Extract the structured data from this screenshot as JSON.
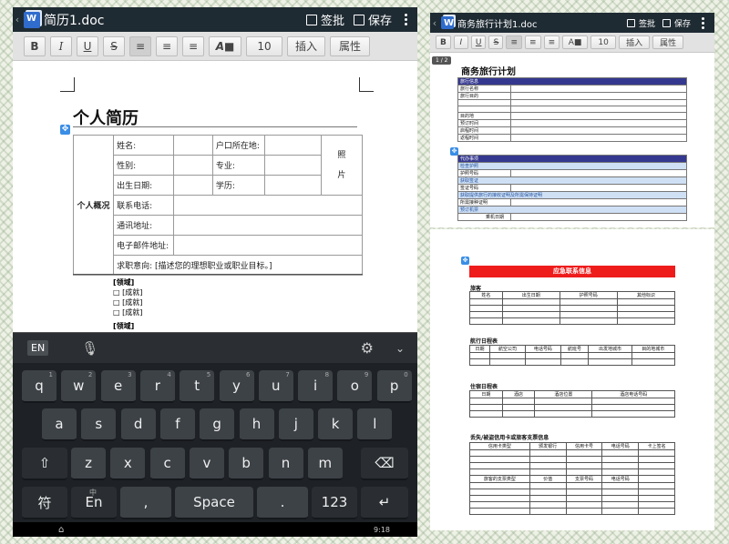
{
  "left": {
    "title": "简历1.doc",
    "approve": "签批",
    "save": "保存",
    "format": {
      "bold": "B",
      "italic": "I",
      "underline": "U",
      "strike": "S",
      "fontsize": "10",
      "insert": "插入",
      "props": "属性"
    },
    "doc_title": "个人简历",
    "section_label": "个人概况",
    "fields": {
      "name": "姓名:",
      "hukou": "户口所在地:",
      "gender": "性别:",
      "major": "专业:",
      "birth": "出生日期:",
      "education": "学历:",
      "phone": "联系电话:",
      "address": "通讯地址:",
      "email": "电子邮件地址:",
      "intent": "求职意向:",
      "intent_value": "[描述您的理想职业或职业目标。]",
      "photo_1": "照",
      "photo_2": "片"
    },
    "areas": [
      {
        "head": "[领域]",
        "items": [
          "[成就]",
          "[成就]",
          "[成就]"
        ]
      },
      {
        "head": "[领域]",
        "items": []
      }
    ],
    "kbd": {
      "lang": "EN",
      "rows": [
        [
          "q",
          "w",
          "e",
          "r",
          "t",
          "y",
          "u",
          "i",
          "o",
          "p"
        ],
        [
          "a",
          "s",
          "d",
          "f",
          "g",
          "h",
          "j",
          "k",
          "l"
        ],
        [
          "z",
          "x",
          "c",
          "v",
          "b",
          "n",
          "m"
        ]
      ],
      "subs": [
        "1",
        "2",
        "3",
        "4",
        "5",
        "6",
        "7",
        "8",
        "9",
        "0"
      ],
      "sym": "符",
      "cn_top": "中",
      "cn": "En",
      "comma": ",",
      "space": "Space",
      "period": ".",
      "num": "123"
    },
    "status_time": "9:18"
  },
  "rtop": {
    "title": "商务旅行计划1.doc",
    "approve": "签批",
    "save": "保存",
    "format": {
      "bold": "B",
      "italic": "I",
      "underline": "U",
      "strike": "S",
      "fontsize": "10",
      "insert": "插入",
      "props": "属性"
    },
    "page": "1 / 2",
    "doc_title": "商务旅行计划",
    "t1_head": "旅行信息",
    "t1_rows": [
      "旅行名称",
      "旅行目的",
      "",
      "",
      "目的地",
      "预订时间",
      "启程时间",
      "返程时间"
    ],
    "t2_head": "代办事项",
    "t2_rows": [
      {
        "t": "检查护照",
        "lt": true
      },
      {
        "t": "护照号码",
        "lt": false
      },
      {
        "t": "获取签证",
        "lt": true
      },
      {
        "t": "签证号码",
        "lt": false
      },
      {
        "t": "获取提供旅行的接收证明及所需保持证明",
        "lt": true
      },
      {
        "t": "所需接种证明",
        "lt": false
      },
      {
        "t": "预订机票",
        "lt": true
      }
    ],
    "t2_extra": "乘机日期"
  },
  "rbot": {
    "banner": "应急联系信息",
    "s1": "旅客",
    "s1_cols": [
      "姓名",
      "出生日期",
      "护照号码",
      "其他标识"
    ],
    "s2": "航行日程表",
    "s2_cols": [
      "日期",
      "航空公司",
      "电话号码",
      "航班号",
      "出发地城市",
      "目的地城市"
    ],
    "s3": "住宿日程表",
    "s3_cols": [
      "日期",
      "酒店",
      "酒店位置",
      "酒店电话号码"
    ],
    "s4": "丢失/被盗信用卡或旅客支票信息",
    "s4_cols": [
      "信用卡类型",
      "颁发银行",
      "信用卡号",
      "电话号码",
      "卡上签名"
    ],
    "s4_cols2": [
      "旅客的支票类型",
      "价值",
      "支票号码",
      "电话号码"
    ]
  }
}
